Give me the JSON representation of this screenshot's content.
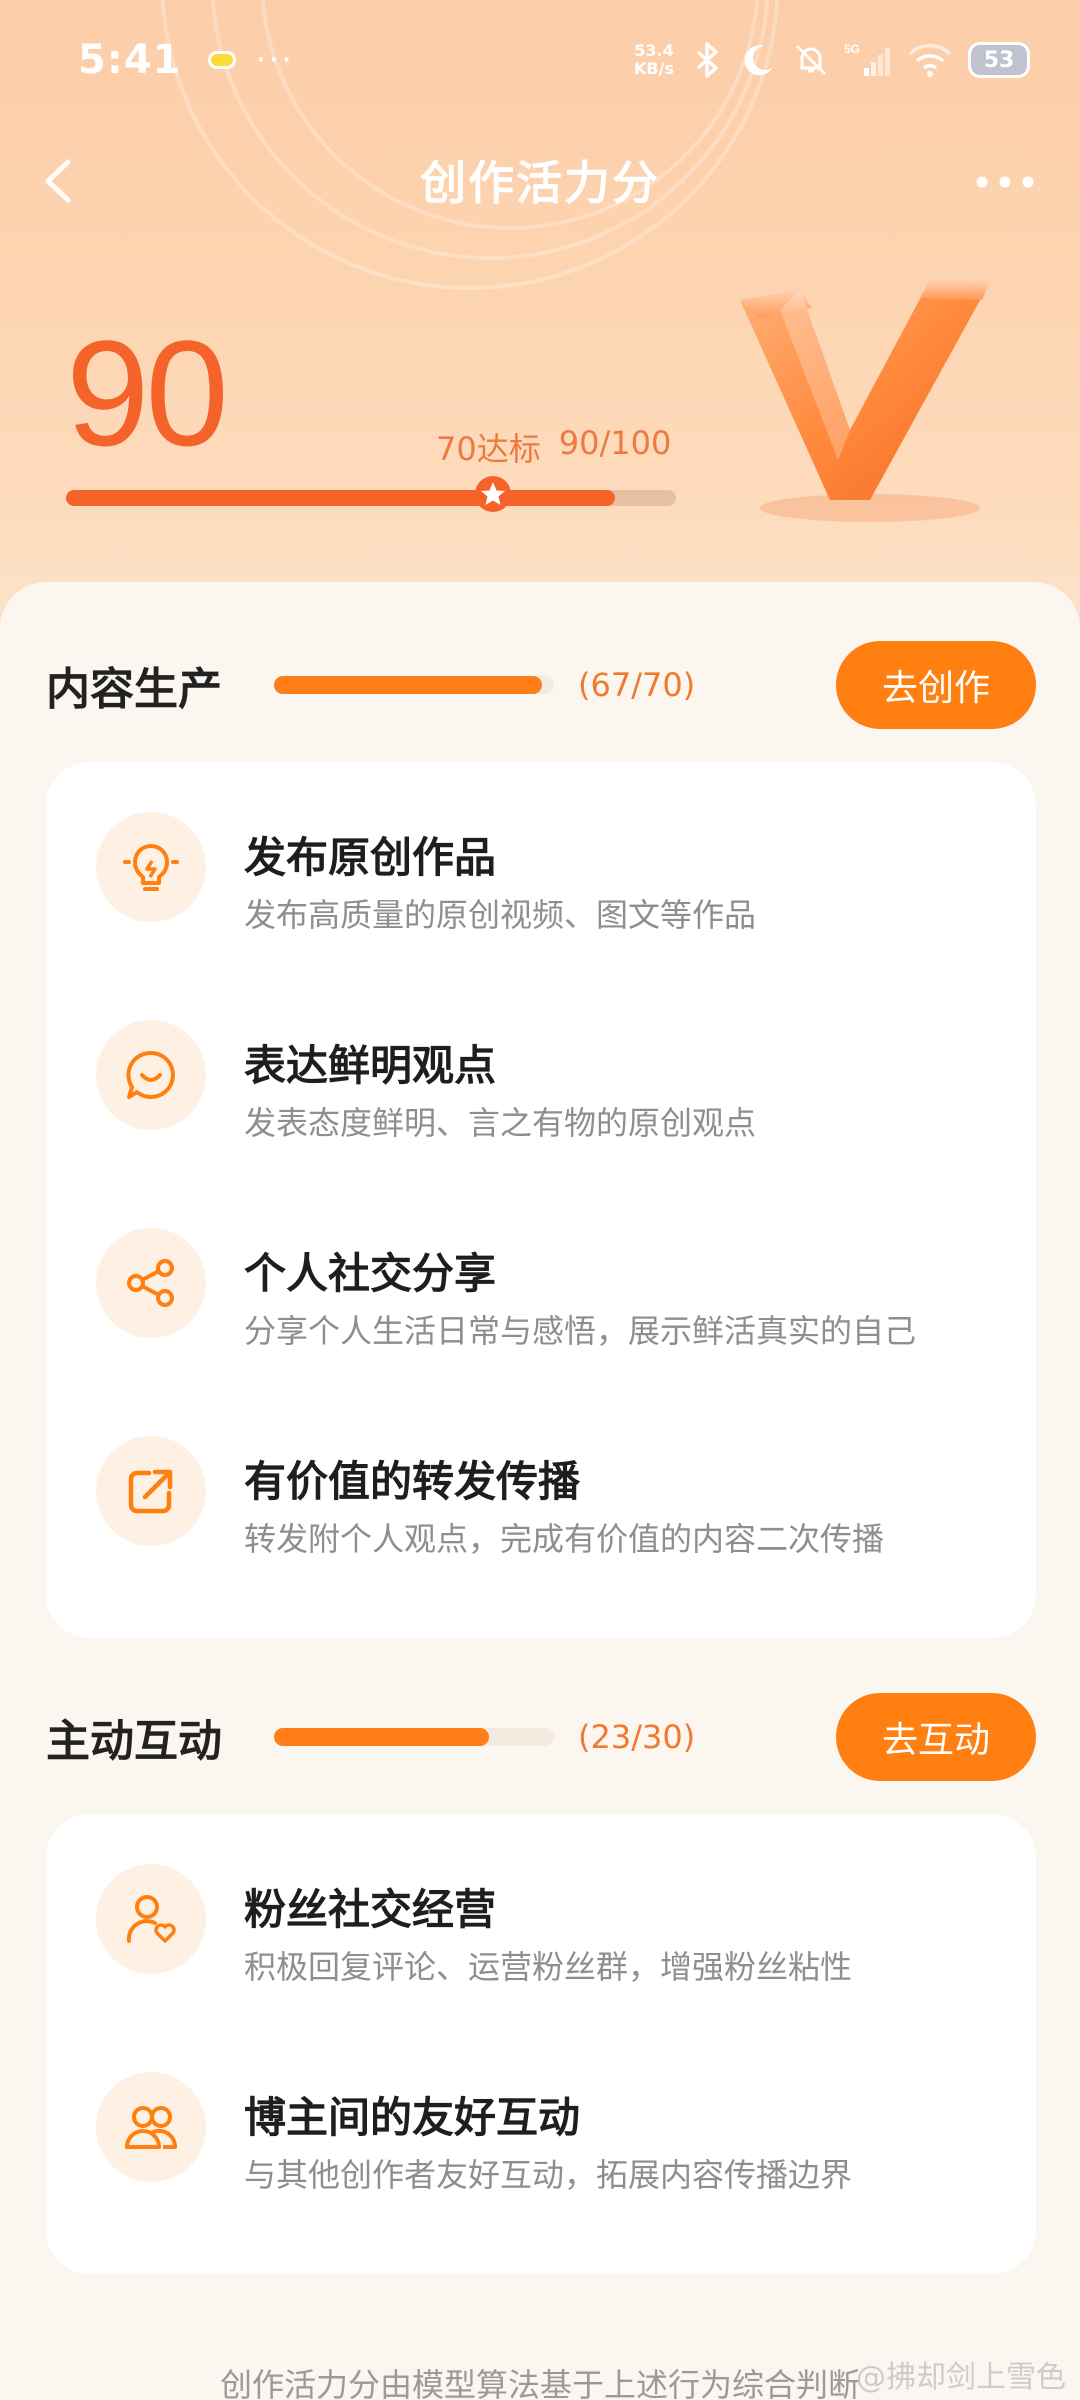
{
  "status_bar": {
    "time": "5:41",
    "dots": "···",
    "net_speed_value": "53.4",
    "net_speed_unit": "KB/s",
    "network": "5G",
    "battery": "53"
  },
  "nav": {
    "title": "创作活力分"
  },
  "score": {
    "value": "90",
    "standard_label": "70达标",
    "ratio_label": "90/100",
    "fraction": 0.9,
    "standard_fraction": 0.7
  },
  "sections": {
    "content": {
      "title": "内容生产",
      "count": "(67/70)",
      "fraction": 0.957,
      "button": "去创作",
      "items": [
        {
          "title": "发布原创作品",
          "desc": "发布高质量的原创视频、图文等作品",
          "icon": "lightbulb-icon"
        },
        {
          "title": "表达鲜明观点",
          "desc": "发表态度鲜明、言之有物的原创观点",
          "icon": "chat-bubble-icon"
        },
        {
          "title": "个人社交分享",
          "desc": "分享个人生活日常与感悟，展示鲜活真实的自己",
          "icon": "share-icon"
        },
        {
          "title": "有价值的转发传播",
          "desc": "转发附个人观点，完成有价值的内容二次传播",
          "icon": "forward-icon"
        }
      ]
    },
    "interaction": {
      "title": "主动互动",
      "count": "(23/30)",
      "fraction": 0.767,
      "button": "去互动",
      "items": [
        {
          "title": "粉丝社交经营",
          "desc": "积极回复评论、运营粉丝群，增强粉丝粘性",
          "icon": "fan-heart-icon"
        },
        {
          "title": "博主间的友好互动",
          "desc": "与其他创作者友好互动，拓展内容传播边界",
          "icon": "users-icon"
        }
      ]
    }
  },
  "footer_note": "创作活力分由模型算法基于上述行为综合判断",
  "watermark": "@拂却剑上雪色",
  "colors": {
    "accent": "#FF7F10",
    "score": "#F4632A",
    "hero_bg": "#FDD3B0"
  }
}
